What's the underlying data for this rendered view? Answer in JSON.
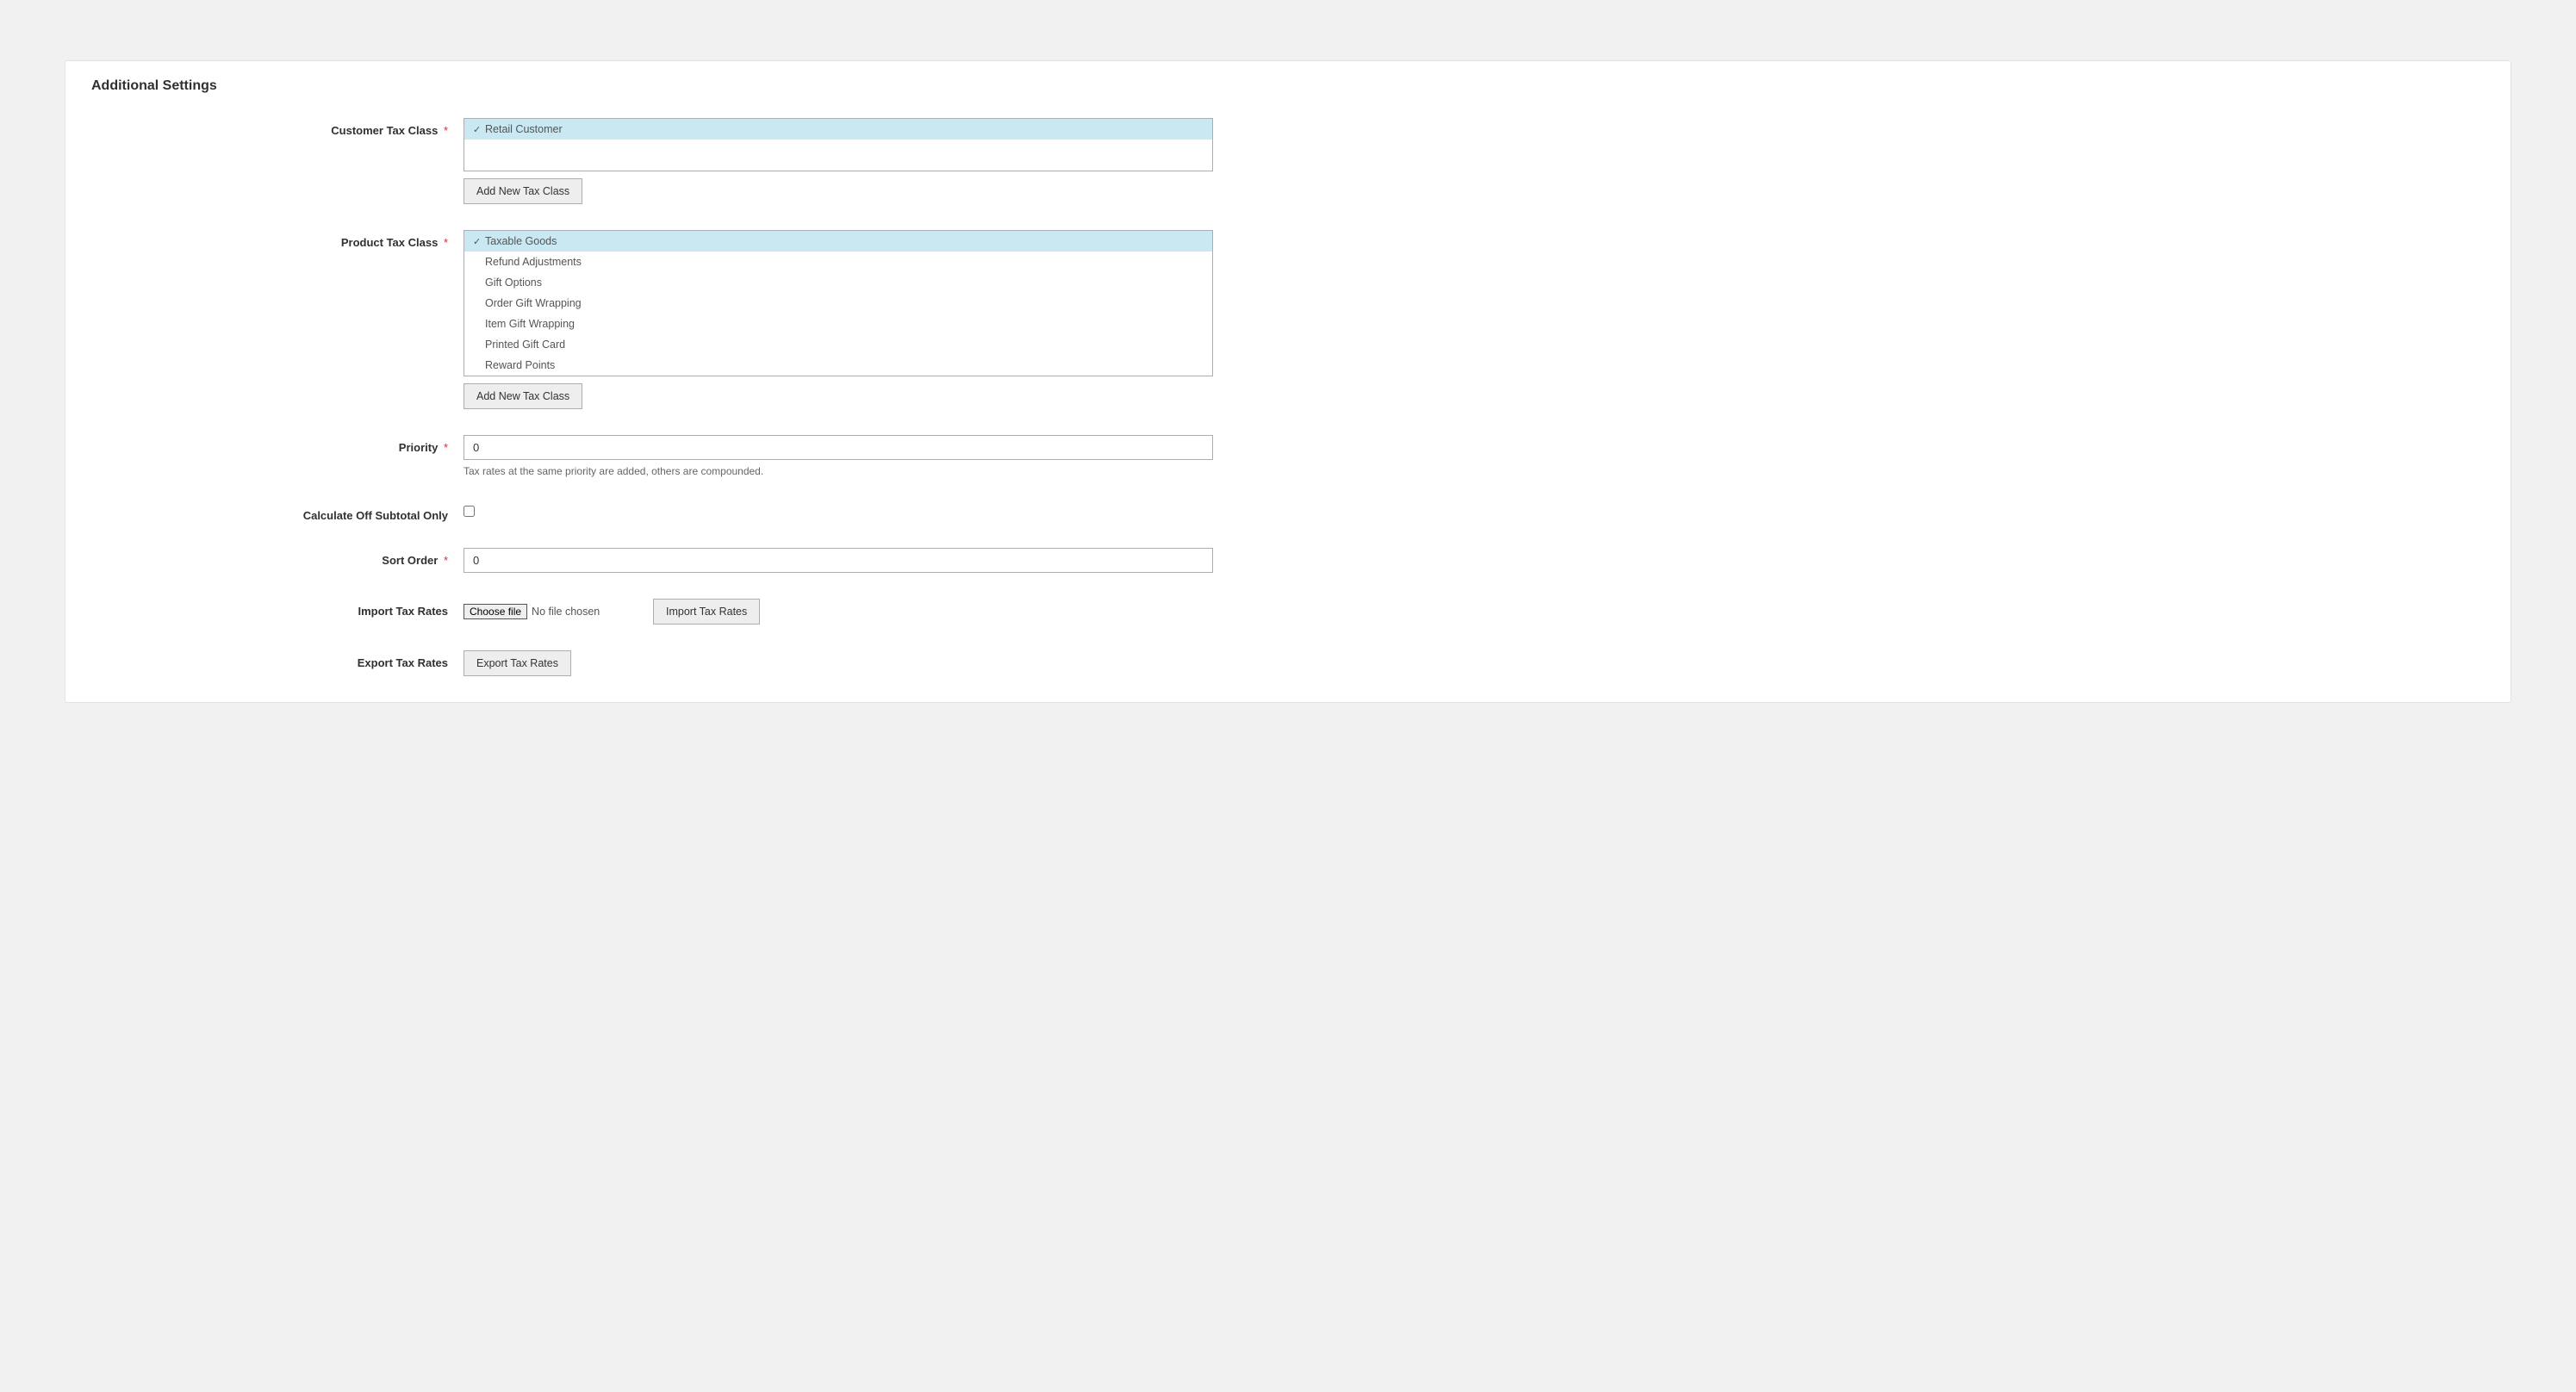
{
  "section_title": "Additional Settings",
  "labels": {
    "customer_tax_class": "Customer Tax Class",
    "product_tax_class": "Product Tax Class",
    "priority": "Priority",
    "calculate_off_subtotal": "Calculate Off Subtotal Only",
    "sort_order": "Sort Order",
    "import_tax_rates": "Import Tax Rates",
    "export_tax_rates": "Export Tax Rates"
  },
  "customer_tax_class": {
    "items": [
      {
        "label": "Retail Customer",
        "selected": true
      }
    ]
  },
  "product_tax_class": {
    "items": [
      {
        "label": "Taxable Goods",
        "selected": true
      },
      {
        "label": "Refund Adjustments",
        "selected": false
      },
      {
        "label": "Gift Options",
        "selected": false
      },
      {
        "label": "Order Gift Wrapping",
        "selected": false
      },
      {
        "label": "Item Gift Wrapping",
        "selected": false
      },
      {
        "label": "Printed Gift Card",
        "selected": false
      },
      {
        "label": "Reward Points",
        "selected": false
      }
    ]
  },
  "buttons": {
    "add_new_tax_class": "Add New Tax Class",
    "import_tax_rates": "Import Tax Rates",
    "export_tax_rates": "Export Tax Rates",
    "choose_file": "Choose file"
  },
  "fields": {
    "priority_value": "0",
    "priority_hint": "Tax rates at the same priority are added, others are compounded.",
    "sort_order_value": "0",
    "no_file_chosen": "No file chosen"
  }
}
